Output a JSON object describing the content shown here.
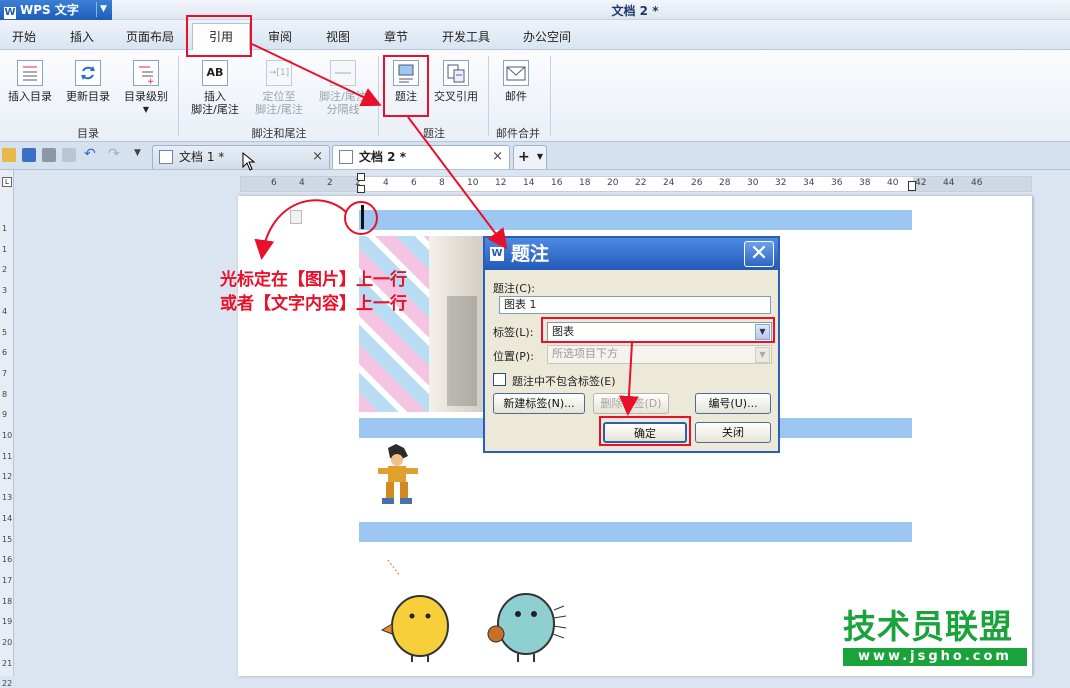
{
  "app": {
    "name": "WPS 文字",
    "document_title": "文档 2 *"
  },
  "ribbon_tabs": [
    {
      "label": "开始"
    },
    {
      "label": "插入"
    },
    {
      "label": "页面布局"
    },
    {
      "label": "引用"
    },
    {
      "label": "审阅"
    },
    {
      "label": "视图"
    },
    {
      "label": "章节"
    },
    {
      "label": "开发工具"
    },
    {
      "label": "办公空间"
    }
  ],
  "active_tab": "引用",
  "ribbon": {
    "toc_group": {
      "label": "目录",
      "insert_toc": "插入目录",
      "update_toc": "更新目录",
      "toc_level": "目录级别"
    },
    "footnote_group": {
      "label": "脚注和尾注",
      "insert_line1": "插入",
      "insert_line2": "脚注/尾注",
      "goto_line1": "定位至",
      "goto_line2": "脚注/尾注",
      "sep_line1": "脚注/尾注",
      "sep_line2": "分隔线"
    },
    "caption_group": {
      "label": "题注",
      "caption": "题注",
      "cross_ref": "交叉引用"
    },
    "mail_group": {
      "label": "邮件合并",
      "mail": "邮件"
    }
  },
  "doc_tabs": [
    {
      "label": "文档 1 *",
      "close": "×"
    },
    {
      "label": "文档 2 *",
      "close": "×"
    }
  ],
  "new_tab_label": "+",
  "ruler": {
    "h_ticks": [
      "6",
      "4",
      "2",
      "2",
      "4",
      "6",
      "8",
      "10",
      "12",
      "14",
      "16",
      "18",
      "20",
      "22",
      "24",
      "26",
      "28",
      "30",
      "32",
      "34",
      "36",
      "38",
      "40",
      "42",
      "44",
      "46"
    ],
    "v_ticks": [
      "1",
      "1",
      "2",
      "3",
      "4",
      "5",
      "6",
      "7",
      "8",
      "9",
      "10",
      "11",
      "12",
      "13",
      "14",
      "15",
      "16",
      "17",
      "18",
      "19",
      "20",
      "21",
      "22"
    ],
    "corner": "L"
  },
  "annotation": {
    "line1": "光标定在【图片】上一行",
    "line2": "或者【文字内容】上一行"
  },
  "dialog": {
    "title": "题注",
    "caption_label": "题注(C):",
    "caption_value": "图表 1",
    "label_label": "标签(L):",
    "label_value": "图表",
    "position_label": "位置(P):",
    "position_value": "所选项目下方",
    "exclude_label_checkbox": "题注中不包含标签(E)",
    "new_label_button": "新建标签(N)...",
    "delete_label_button": "删除标签(D)",
    "numbering_button": "编号(U)...",
    "ok_button": "确定",
    "close_button": "关闭",
    "close_icon": "✕"
  },
  "watermark": {
    "text": "技术员联盟",
    "url": "www.jsgho.com"
  },
  "colors": {
    "annotation_red": "#e8102a",
    "title_blue": "#2359b8",
    "highlight_blue": "#9cc7f2",
    "watermark_green": "#1aa23b"
  }
}
